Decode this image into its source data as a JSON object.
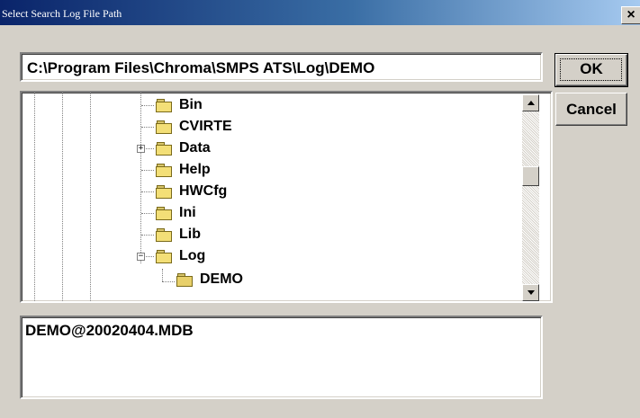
{
  "window": {
    "title": "Select Search Log File Path",
    "close_label": "×"
  },
  "path": {
    "value": "C:\\Program Files\\Chroma\\SMPS ATS\\Log\\DEMO"
  },
  "buttons": {
    "ok": "OK",
    "cancel": "Cancel"
  },
  "tree": {
    "items": [
      {
        "label": "Bin",
        "icon": "folder-icon",
        "expander": ""
      },
      {
        "label": "CVIRTE",
        "icon": "folder-icon",
        "expander": ""
      },
      {
        "label": "Data",
        "icon": "folder-icon",
        "expander": "+"
      },
      {
        "label": "Help",
        "icon": "folder-icon",
        "expander": ""
      },
      {
        "label": "HWCfg",
        "icon": "folder-icon",
        "expander": ""
      },
      {
        "label": "Ini",
        "icon": "folder-icon",
        "expander": ""
      },
      {
        "label": "Lib",
        "icon": "folder-icon",
        "expander": ""
      },
      {
        "label": "Log",
        "icon": "folder-icon",
        "expander": "−"
      },
      {
        "label": "DEMO",
        "icon": "open-folder-icon",
        "expander": ""
      }
    ]
  },
  "files": {
    "items": [
      "DEMO@20020404.MDB"
    ]
  },
  "colors": {
    "dialog_bg": "#d4d0c8",
    "title_start": "#0a246a",
    "title_end": "#a6caf0",
    "folder": "#f3df77"
  }
}
